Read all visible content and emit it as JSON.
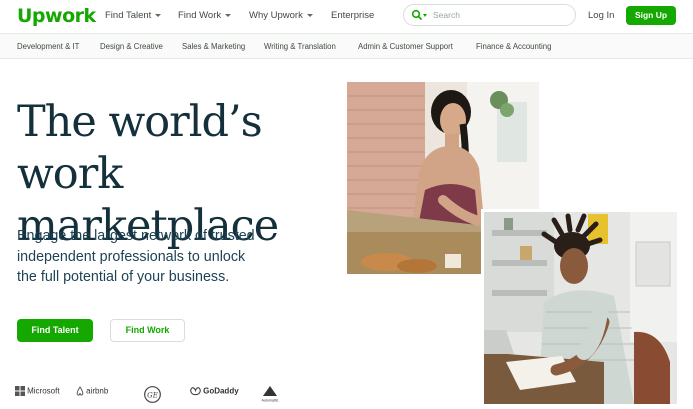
{
  "header": {
    "logo": "Upwork",
    "nav": [
      {
        "label": "Find Talent",
        "has_dropdown": true
      },
      {
        "label": "Find Work",
        "has_dropdown": true
      },
      {
        "label": "Why Upwork",
        "has_dropdown": true
      },
      {
        "label": "Enterprise",
        "has_dropdown": false
      }
    ],
    "search_placeholder": "Search",
    "login": "Log In",
    "signup": "Sign Up"
  },
  "categories": [
    "Development & IT",
    "Design & Creative",
    "Sales & Marketing",
    "Writing & Translation",
    "Admin & Customer Support",
    "Finance & Accounting"
  ],
  "hero": {
    "title_line1": "The world’s work",
    "title_line2": "marketplace",
    "subtitle_line1": "Engage the largest network of trusted",
    "subtitle_line2": "independent professionals to unlock",
    "subtitle_line3": "the full potential of your business.",
    "primary_cta": "Find Talent",
    "secondary_cta": "Find Work"
  },
  "trusted_by": [
    "Microsoft",
    "airbnb",
    "GE",
    "GoDaddy",
    "Automattic"
  ],
  "colors": {
    "brand_green": "#14a800",
    "heading_navy": "#14303b",
    "body_text": "#1d4354"
  }
}
